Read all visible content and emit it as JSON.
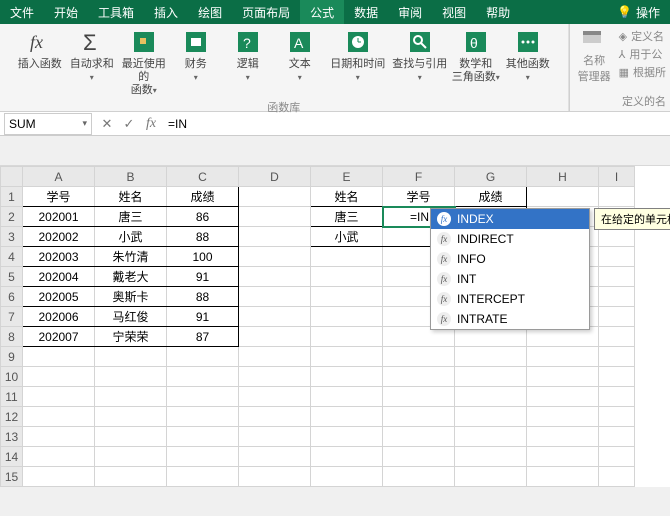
{
  "colors": {
    "brand": "#0b6e46",
    "accent": "#1a8a5a",
    "selection": "#3373c6"
  },
  "tabs": {
    "items": [
      "文件",
      "开始",
      "工具箱",
      "插入",
      "绘图",
      "页面布局",
      "公式",
      "数据",
      "审阅",
      "视图",
      "帮助"
    ],
    "active_index": 6,
    "right": {
      "bulb_label": "操作"
    }
  },
  "ribbon": {
    "insert_fn": "插入函数",
    "autosum_lines": [
      "自动求和",
      ""
    ],
    "recent_lines": [
      "最近使用的",
      "函数"
    ],
    "finance_lines": [
      "财务",
      ""
    ],
    "logic_lines": [
      "逻辑",
      ""
    ],
    "text_lines": [
      "文本",
      ""
    ],
    "datetime_lines": [
      "日期和时间",
      ""
    ],
    "lookup_lines": [
      "查找与引用",
      ""
    ],
    "math_lines": [
      "数学和",
      "三角函数"
    ],
    "other_lines": [
      "其他函数",
      ""
    ],
    "group_label": "函数库",
    "name_mgr": "名称\n管理器",
    "def_name": "定义名",
    "use_in_formula": "用于公",
    "create_from_sel": "根据所",
    "def_group": "定义的名"
  },
  "formula_bar": {
    "name_box": "SUM",
    "cancel": "✕",
    "enter": "✓",
    "fx": "fx",
    "formula": "=IN"
  },
  "columns": [
    "A",
    "B",
    "C",
    "D",
    "E",
    "F",
    "G",
    "H",
    "I"
  ],
  "rows": [
    "1",
    "2",
    "3",
    "4",
    "5",
    "6",
    "7",
    "8",
    "9",
    "10",
    "11",
    "12",
    "13",
    "14",
    "15"
  ],
  "table1": {
    "headers": [
      "学号",
      "姓名",
      "成绩"
    ],
    "data": [
      [
        "202001",
        "唐三",
        "86"
      ],
      [
        "202002",
        "小武",
        "88"
      ],
      [
        "202003",
        "朱竹清",
        "100"
      ],
      [
        "202004",
        "戴老大",
        "91"
      ],
      [
        "202005",
        "奥斯卡",
        "88"
      ],
      [
        "202006",
        "马红俊",
        "91"
      ],
      [
        "202007",
        "宁荣荣",
        "87"
      ]
    ]
  },
  "table2": {
    "headers": [
      "姓名",
      "学号",
      "成绩"
    ],
    "data": [
      [
        "唐三",
        "=IN",
        ""
      ],
      [
        "小武",
        "",
        ""
      ]
    ]
  },
  "active_cell_value": "=IN",
  "autocomplete": {
    "items": [
      "INDEX",
      "INDIRECT",
      "INFO",
      "INT",
      "INTERCEPT",
      "INTRATE"
    ],
    "selected_index": 0,
    "tooltip": "在给定的单元格区域中，返回"
  }
}
